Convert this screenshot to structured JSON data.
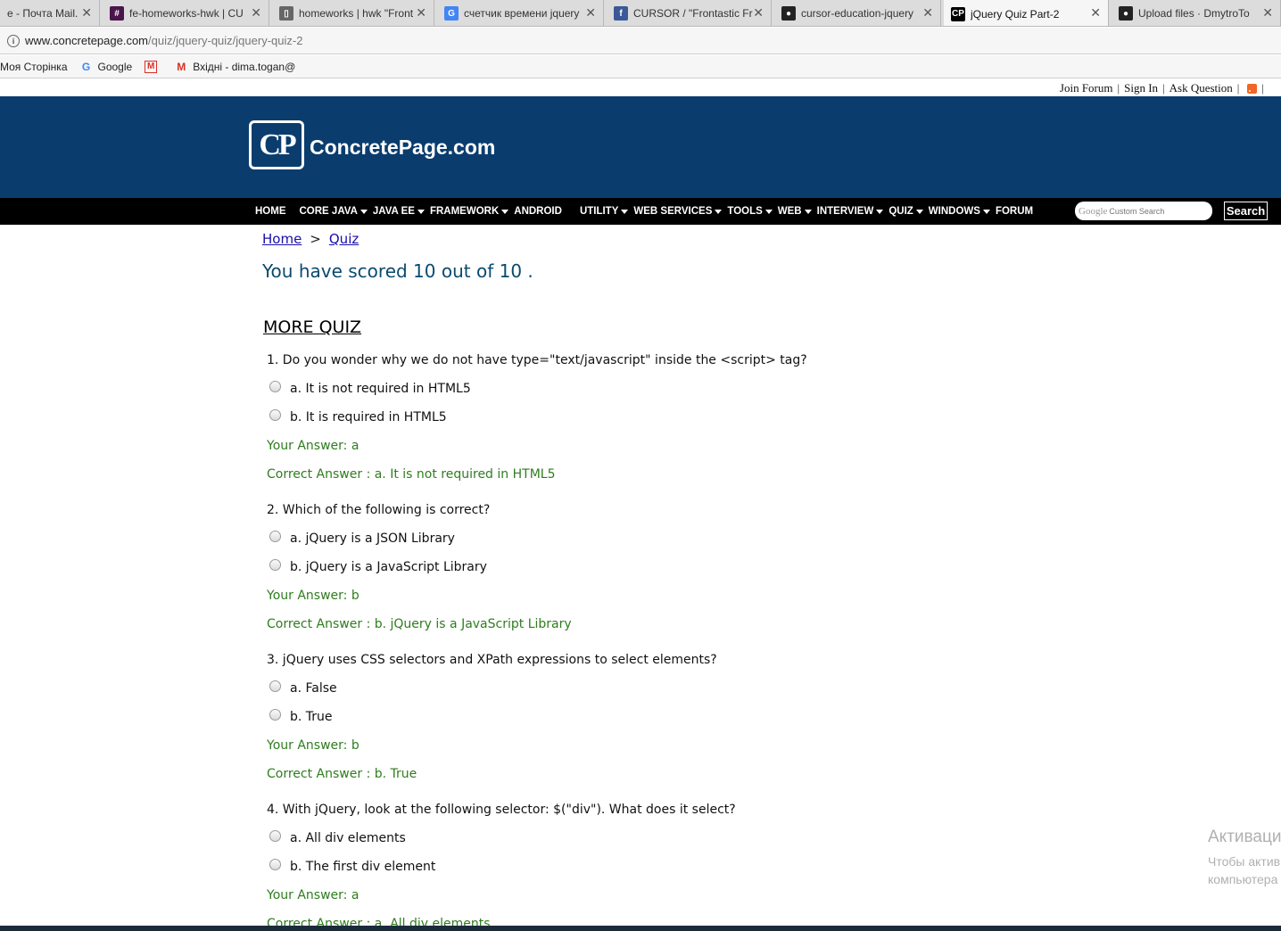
{
  "browser": {
    "tabs": [
      {
        "title": "е - Почта Mail.",
        "icon": "mail-icon",
        "color": "#168de2"
      },
      {
        "title": "fe-homeworks-hwk | CU",
        "icon": "slack-icon",
        "color": "#4a154b"
      },
      {
        "title": "homeworks | hwk \"Front",
        "icon": "trello-icon",
        "color": "#666666"
      },
      {
        "title": "счетчик времени jquery",
        "icon": "google-icon",
        "color": "#4285f4"
      },
      {
        "title": "CURSOR / \"Frontastic Fr",
        "icon": "facebook-icon",
        "color": "#3b5998"
      },
      {
        "title": "cursor-education-jquery",
        "icon": "github-icon",
        "color": "#222222"
      },
      {
        "title": "jQuery Quiz Part-2",
        "icon": "cp-icon",
        "color": "#000000"
      },
      {
        "title": "Upload files · DmytroTo",
        "icon": "github-icon",
        "color": "#222222"
      }
    ],
    "url_host": "www.concretepage.com",
    "url_path": "/quiz/jquery-quiz/jquery-quiz-2",
    "bookmarks": [
      {
        "label": "Моя Сторінка"
      },
      {
        "label": "Google"
      },
      {
        "label": ""
      },
      {
        "label": "Вхідні - dima.togan@"
      }
    ]
  },
  "site": {
    "toplinks": {
      "join": "Join Forum",
      "signin": "Sign In",
      "ask": "Ask Question",
      "sep": "|"
    },
    "logo_mark": "CP",
    "logo_text": "ConcretePage.com",
    "nav": [
      {
        "label": "HOME",
        "dropdown": false
      },
      {
        "label": "CORE JAVA",
        "dropdown": true
      },
      {
        "label": "JAVA EE",
        "dropdown": true
      },
      {
        "label": "FRAMEWORK",
        "dropdown": true
      },
      {
        "label": "ANDROID",
        "dropdown": false
      },
      {
        "label": "UTILITY",
        "dropdown": true
      },
      {
        "label": "WEB SERVICES",
        "dropdown": true
      },
      {
        "label": "TOOLS",
        "dropdown": true
      },
      {
        "label": "WEB",
        "dropdown": true
      },
      {
        "label": "INTERVIEW",
        "dropdown": true
      },
      {
        "label": "QUIZ",
        "dropdown": true
      },
      {
        "label": "WINDOWS",
        "dropdown": true
      },
      {
        "label": "FORUM",
        "dropdown": false
      }
    ],
    "search": {
      "logo": "Google",
      "placeholder": "Custom Search",
      "button": "Search"
    }
  },
  "content": {
    "breadcrumb": {
      "home": "Home",
      "sep": ">",
      "quiz": "Quiz"
    },
    "score": "You have scored 10 out of 10 .",
    "more_quiz": "MORE QUIZ",
    "questions": [
      {
        "question": "1. Do you wonder why we do not have type=\"text/javascript\" inside the <script> tag?",
        "options": [
          "a. It is not required in HTML5",
          "b. It is required in HTML5"
        ],
        "your_answer": "Your Answer: a",
        "correct_answer": "Correct Answer : a. It is not required in HTML5"
      },
      {
        "question": "2. Which of the following is correct?",
        "options": [
          "a. jQuery is a JSON Library",
          "b. jQuery is a JavaScript Library"
        ],
        "your_answer": "Your Answer: b",
        "correct_answer": "Correct Answer : b. jQuery is a JavaScript Library"
      },
      {
        "question": "3. jQuery uses CSS selectors and XPath expressions to select elements?",
        "options": [
          "a. False",
          "b. True"
        ],
        "your_answer": "Your Answer: b",
        "correct_answer": "Correct Answer : b. True"
      },
      {
        "question": "4. With jQuery, look at the following selector: $(\"div\"). What does it select?",
        "options": [
          "a. All div elements",
          "b. The first div element"
        ],
        "your_answer": "Your Answer: a",
        "correct_answer": "Correct Answer : a. All div elements"
      }
    ]
  },
  "watermark": {
    "line1": "Активаци",
    "line2": "Чтобы актив",
    "line3": "компьютера"
  },
  "colors": {
    "header": "#0a3d6e",
    "navbar": "#000000",
    "score": "#0a4a6e",
    "answer": "#2e7d1e"
  }
}
